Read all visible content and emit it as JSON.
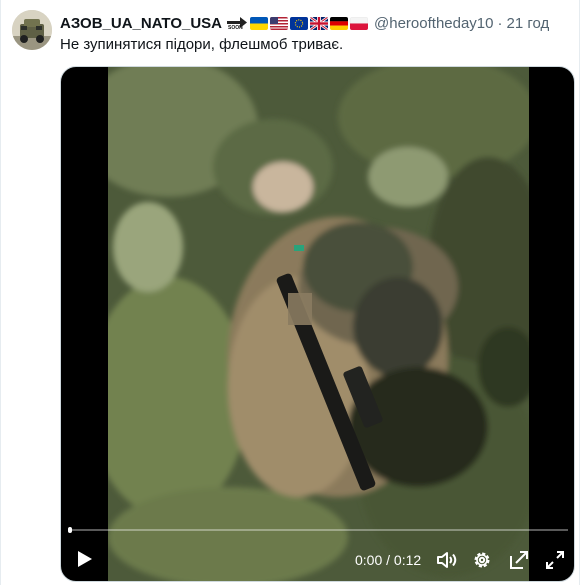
{
  "tweet": {
    "display_name": "АЗОВ_UA_NATO_USA",
    "handle": "@herooftheday10",
    "separator": "·",
    "time": "21 год",
    "text": "Не зупинятися підори, флешмоб триває.",
    "name_emojis": [
      "soon-arrow",
      "flag-ua",
      "flag-us",
      "flag-eu",
      "flag-uk",
      "flag-de",
      "flag-pl"
    ],
    "soon_text": "SOON"
  },
  "video": {
    "timecode": "0:00 / 0:12",
    "progress": 0.0,
    "controls": [
      "play-icon",
      "volume-icon",
      "settings-gear-icon",
      "pop-out-icon",
      "fullscreen-icon"
    ]
  },
  "colors": {
    "text_primary": "#0f1419",
    "text_secondary": "#536471",
    "video_background": "#000000"
  }
}
